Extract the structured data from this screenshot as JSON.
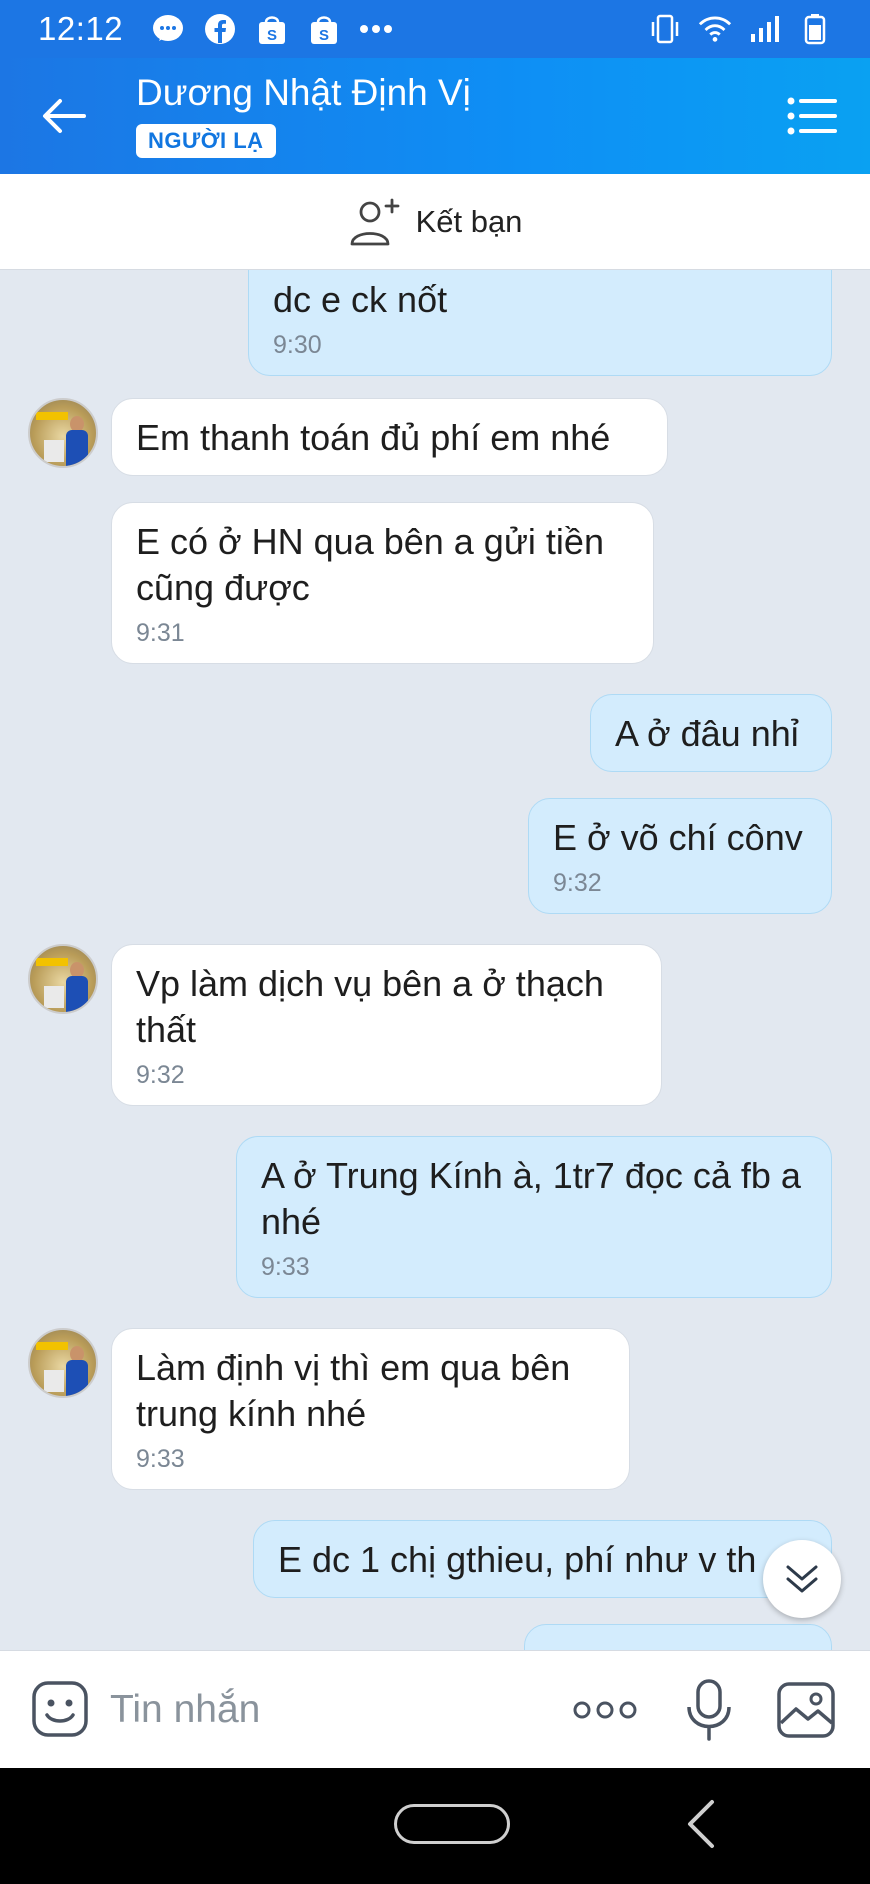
{
  "status_bar": {
    "time": "12:12"
  },
  "header": {
    "title": "Dương Nhật Định Vị",
    "badge": "NGƯỜI LẠ"
  },
  "add_friend": {
    "label": "Kết bạn"
  },
  "messages": [
    {
      "side": "out",
      "text": "dc e ck nốt",
      "time": "9:30"
    },
    {
      "side": "in",
      "text": "Em thanh toán đủ phí em nhé",
      "time": ""
    },
    {
      "side": "in",
      "text": "E có ở HN qua bên a gửi tiền cũng được",
      "time": "9:31"
    },
    {
      "side": "out",
      "text": "A ở đâu nhỉ",
      "time": ""
    },
    {
      "side": "out",
      "text": "E ở võ chí cônv",
      "time": "9:32"
    },
    {
      "side": "in",
      "text": "Vp làm dịch vụ bên a ở thạch thất",
      "time": "9:32"
    },
    {
      "side": "out",
      "text": "A ở Trung Kính à, 1tr7 đọc cả fb a nhé",
      "time": "9:33"
    },
    {
      "side": "in",
      "text": "Làm định vị thì em qua bên trung kính nhé",
      "time": "9:33"
    },
    {
      "side": "out",
      "text": "E dc 1 chị gthieu, phí như v th",
      "time": ""
    }
  ],
  "input": {
    "placeholder": "Tin nhắn"
  },
  "colors": {
    "primary": "#1c76e4",
    "outgoing_bubble": "#d3ecfd",
    "incoming_bubble": "#ffffff",
    "chat_bg": "#e2e8f0"
  },
  "icons": [
    "back-arrow-icon",
    "menu-list-icon",
    "add-friend-icon",
    "emoji-icon",
    "more-dots-icon",
    "mic-icon",
    "image-icon",
    "chevron-double-down-icon"
  ]
}
